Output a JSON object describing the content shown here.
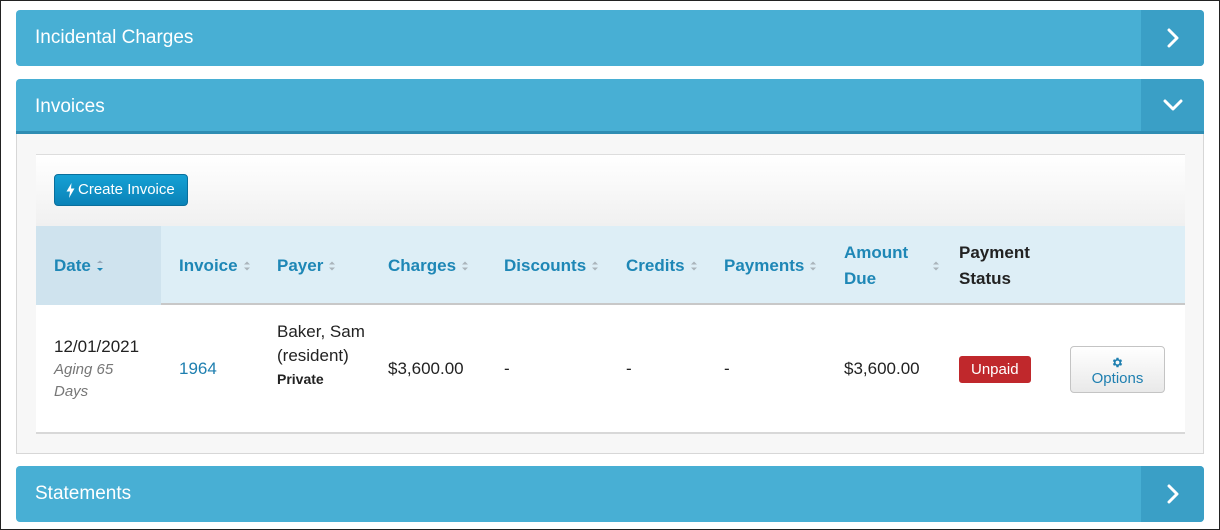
{
  "panels": {
    "incidental": {
      "title": "Incidental Charges",
      "toggle_icon": "chevron-right-icon"
    },
    "invoices": {
      "title": "Invoices",
      "toggle_icon": "chevron-down-icon"
    },
    "statements": {
      "title": "Statements",
      "toggle_icon": "chevron-right-icon"
    }
  },
  "toolbar": {
    "create_label": "Create Invoice",
    "create_icon": "bolt-icon"
  },
  "table": {
    "columns": [
      {
        "label": "Date",
        "sortable": true,
        "sorted": true
      },
      {
        "label": "Invoice",
        "sortable": true
      },
      {
        "label": "Payer",
        "sortable": true
      },
      {
        "label": "Charges",
        "sortable": true
      },
      {
        "label": "Discounts",
        "sortable": true
      },
      {
        "label": "Credits",
        "sortable": true
      },
      {
        "label": "Payments",
        "sortable": true
      },
      {
        "label": "Amount Due",
        "sortable": true
      },
      {
        "label": "Payment Status",
        "sortable": false
      }
    ],
    "rows": [
      {
        "date": "12/01/2021",
        "aging": "Aging 65 Days",
        "invoice": "1964",
        "payer_name": "Baker, Sam (resident)",
        "payer_type": "Private",
        "charges": "$3,600.00",
        "discounts": "-",
        "credits": "-",
        "payments": "-",
        "amount_due": "$3,600.00",
        "status": "Unpaid",
        "options_label": "Options"
      }
    ]
  },
  "colors": {
    "panel_header": "#48afd4",
    "panel_toggle": "#3a9fc6",
    "table_header": "#ddeef6",
    "link": "#1e87b6",
    "unpaid_badge": "#c0282c",
    "create_button": "#0a83b8"
  }
}
